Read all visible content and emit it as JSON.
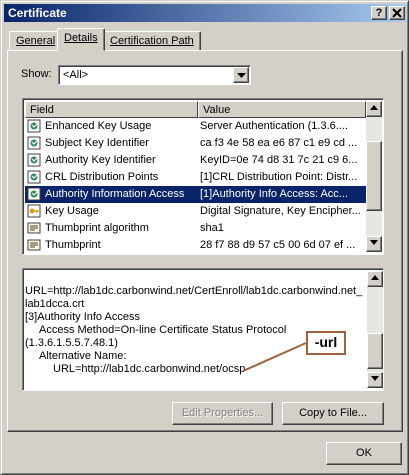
{
  "window": {
    "title": "Certificate",
    "help_button": "?",
    "close_button": "X"
  },
  "tabs": [
    {
      "label": "General"
    },
    {
      "label": "Details"
    },
    {
      "label": "Certification Path"
    }
  ],
  "show": {
    "label": "Show:",
    "selected": "<All>"
  },
  "list": {
    "columns": [
      "Field",
      "Value"
    ],
    "rows": [
      {
        "field": "Enhanced Key Usage",
        "value": "Server Authentication (1.3.6....",
        "icon": "certificate-extension-icon"
      },
      {
        "field": "Subject Key Identifier",
        "value": "ca f3 4e 58 ea e6 87 c1 e9 cd ...",
        "icon": "certificate-extension-icon"
      },
      {
        "field": "Authority Key Identifier",
        "value": "KeyID=0e 74 d8 31 7c 21 c9 6...",
        "icon": "certificate-extension-icon"
      },
      {
        "field": "CRL Distribution Points",
        "value": "[1]CRL Distribution Point: Distr...",
        "icon": "certificate-extension-icon"
      },
      {
        "field": "Authority Information Access",
        "value": "[1]Authority Info Access: Acc...",
        "icon": "certificate-extension-icon",
        "selected": true
      },
      {
        "field": "Key Usage",
        "value": "Digital Signature, Key Encipher...",
        "icon": "key-usage-icon"
      },
      {
        "field": "Thumbprint algorithm",
        "value": "sha1",
        "icon": "certificate-property-icon"
      },
      {
        "field": "Thumbprint",
        "value": "28 f7 88 d9 57 c5 00 6d 07 ef ...",
        "icon": "certificate-property-icon"
      }
    ]
  },
  "details_text": [
    "URL=http://lab1dc.carbonwind.net/CertEnroll/lab1dc.carbonwind.net_",
    "lab1dcca.crt",
    "[3]Authority Info Access",
    "     Access Method=On-line Certificate Status Protocol",
    "(1.3.6.1.5.5.7.48.1)",
    "     Alternative Name:",
    "          URL=http://lab1dc.carbonwind.net/ocsp"
  ],
  "callout": {
    "text": "-url",
    "color": "#a0623a"
  },
  "buttons": {
    "edit_properties": "Edit Properties...",
    "copy_to_file": "Copy to File...",
    "ok": "OK"
  },
  "colors": {
    "selection": "#0a246a",
    "face": "#d4d0c8",
    "title_start": "#0a246a",
    "title_end": "#a6caf0"
  }
}
